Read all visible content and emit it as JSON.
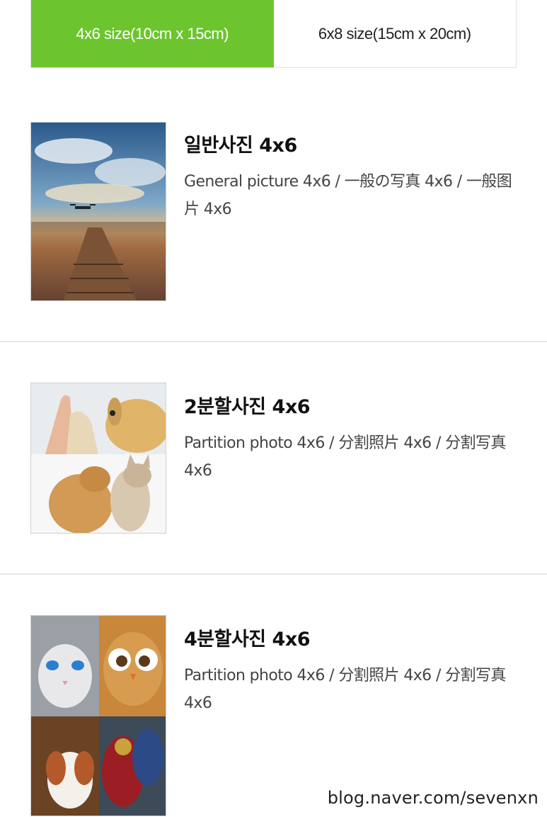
{
  "tabs": [
    {
      "label": "4x6 size(10cm x 15cm)",
      "active": true
    },
    {
      "label": "6x8 size(15cm x 20cm)",
      "active": false
    }
  ],
  "items": [
    {
      "title": "일반사진 4x6",
      "description": "General picture 4x6 / 一般の写真 4x6 / 一般图片 4x6"
    },
    {
      "title": "2분할사진 4x6",
      "description": "Partition photo 4x6 / 分割照片 4x6 / 分割写真 4x6"
    },
    {
      "title": "4분할사진 4x6",
      "description": "Partition photo 4x6 / 分割照片 4x6 / 分割写真 4x6"
    }
  ],
  "watermark": "blog.naver.com/sevenxn",
  "colors": {
    "accent": "#6cc52e",
    "divider": "#e6e6e6"
  }
}
